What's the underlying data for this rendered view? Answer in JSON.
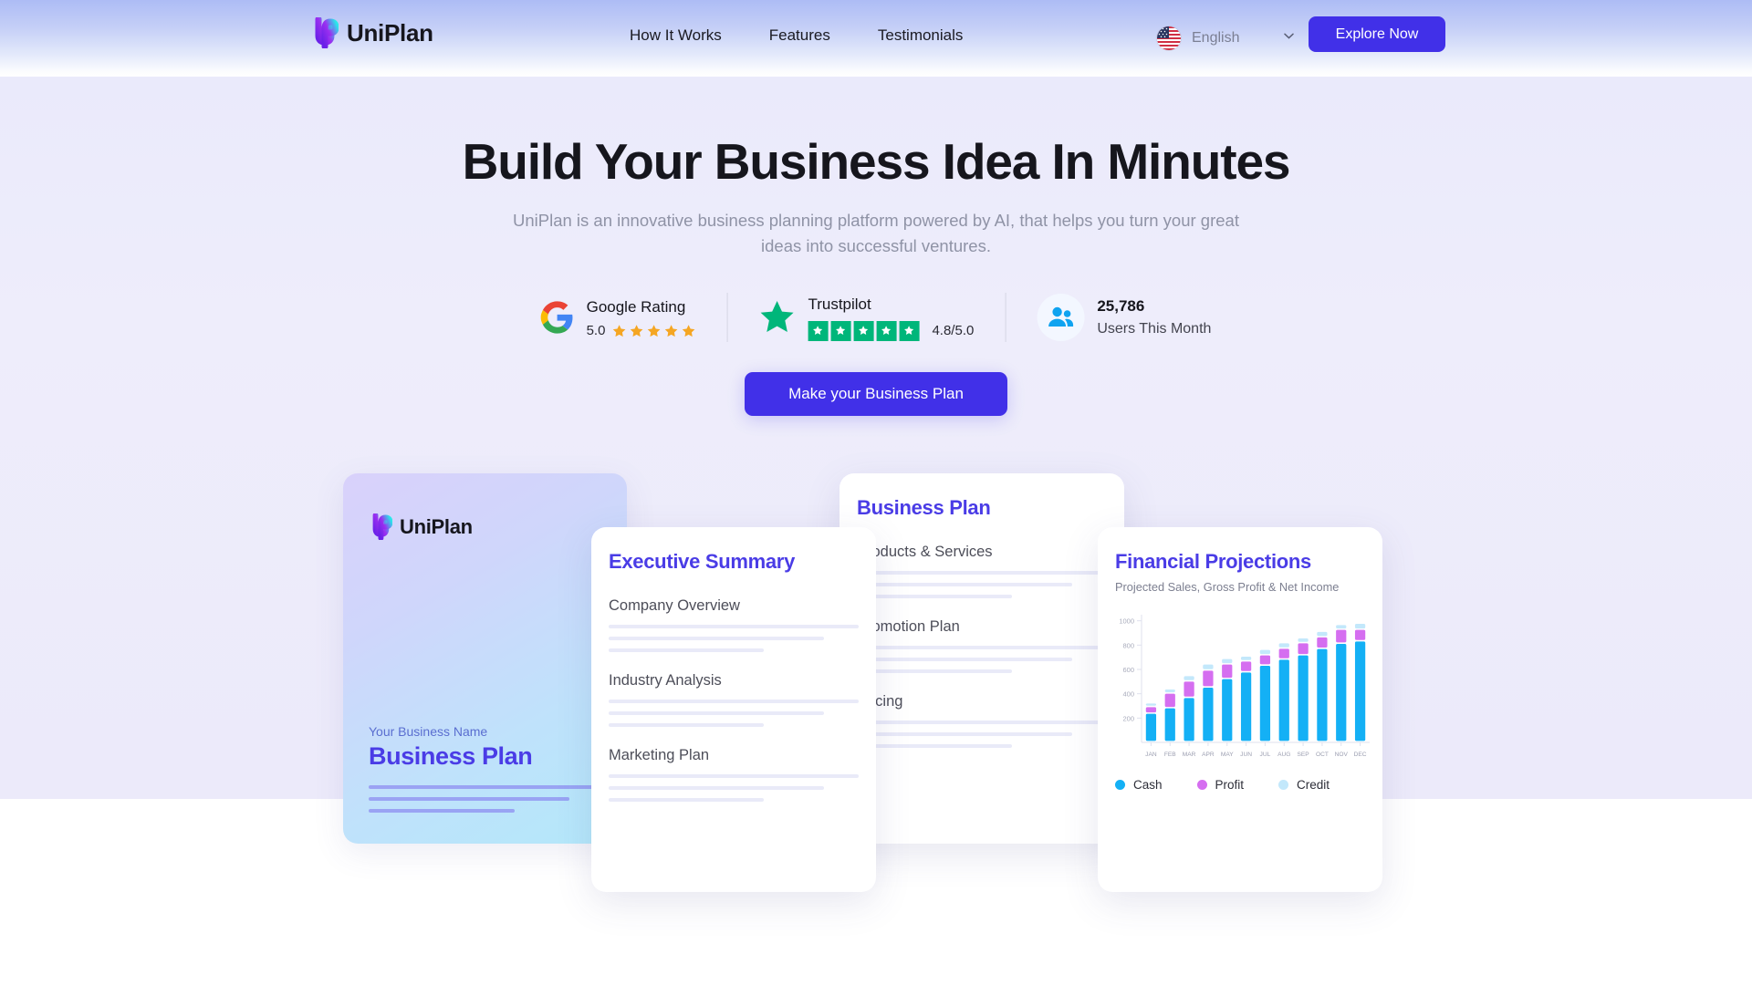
{
  "header": {
    "brand": {
      "name": "UniPlan",
      "logo_icon": "uniplan-logo-icon"
    },
    "nav": [
      {
        "label": "How It Works"
      },
      {
        "label": "Features"
      },
      {
        "label": "Testimonials"
      }
    ],
    "language": {
      "value": "English",
      "flag_icon": "us-flag-icon",
      "chevron_icon": "chevron-down-icon"
    },
    "explore_button": "Explore Now"
  },
  "hero": {
    "title": "Build Your Business Idea In Minutes",
    "subtitle": "UniPlan is an innovative business planning platform powered by AI, that helps you turn your great ideas into successful ventures.",
    "cta": "Make your Business Plan"
  },
  "ratings": {
    "google": {
      "icon": "google-g-icon",
      "title": "Google Rating",
      "score": "5.0",
      "stars": 5,
      "star_color": "#f5a623"
    },
    "trustpilot": {
      "icon": "trustpilot-star-icon",
      "title": "Trustpilot",
      "stars": 5,
      "score": "4.8/5.0",
      "box_color": "#00b67a"
    },
    "users": {
      "icon": "users-group-icon",
      "count": "25,786",
      "label": "Users This Month",
      "icon_color": "#0fa3f0"
    }
  },
  "cards": {
    "cover": {
      "brand": "UniPlan",
      "eyebrow": "Your Business Name",
      "title": "Business Plan"
    },
    "executive": {
      "title": "Executive Summary",
      "sections": [
        "Company Overview",
        "Industry Analysis",
        "Marketing Plan"
      ]
    },
    "plan": {
      "title": "Business Plan",
      "sections": [
        "Products & Services",
        "Promotion Plan",
        "Pricing"
      ]
    },
    "financial": {
      "title": "Financial Projections",
      "subtitle": "Projected Sales, Gross Profit & Net Income"
    }
  },
  "chart_data": {
    "type": "bar",
    "title": "Financial Projections",
    "subtitle": "Projected Sales, Gross Profit & Net Income",
    "stacked": true,
    "categories": [
      "JAN",
      "FEB",
      "MAR",
      "APR",
      "MAY",
      "JUN",
      "JUL",
      "AUG",
      "SEP",
      "OCT",
      "NOV",
      "DEC"
    ],
    "series": [
      {
        "name": "Cash",
        "color": "#14b0f5",
        "values": [
          235,
          280,
          365,
          450,
          520,
          575,
          630,
          680,
          715,
          768,
          810,
          830
        ]
      },
      {
        "name": "Profit",
        "color": "#d56ef0",
        "values": [
          55,
          120,
          135,
          140,
          120,
          90,
          85,
          90,
          100,
          95,
          115,
          95
        ]
      },
      {
        "name": "Credit",
        "color": "#c3e8fb",
        "values": [
          30,
          35,
          45,
          50,
          45,
          40,
          45,
          45,
          40,
          45,
          40,
          50
        ]
      }
    ],
    "ylabel": "",
    "xlabel": "",
    "ylim": [
      0,
      1050
    ],
    "yticks": [
      200,
      400,
      600,
      800,
      1000
    ],
    "grid": false,
    "legend": [
      {
        "label": "Cash",
        "color": "#14b0f5"
      },
      {
        "label": "Profit",
        "color": "#d56ef0"
      },
      {
        "label": "Credit",
        "color": "#c3e8fb"
      }
    ],
    "legend_position": "bottom-left"
  },
  "colors": {
    "accent": "#4130e8",
    "heading": "#16161d",
    "muted": "#8f93a6",
    "page_bg": "#ecebfa"
  }
}
